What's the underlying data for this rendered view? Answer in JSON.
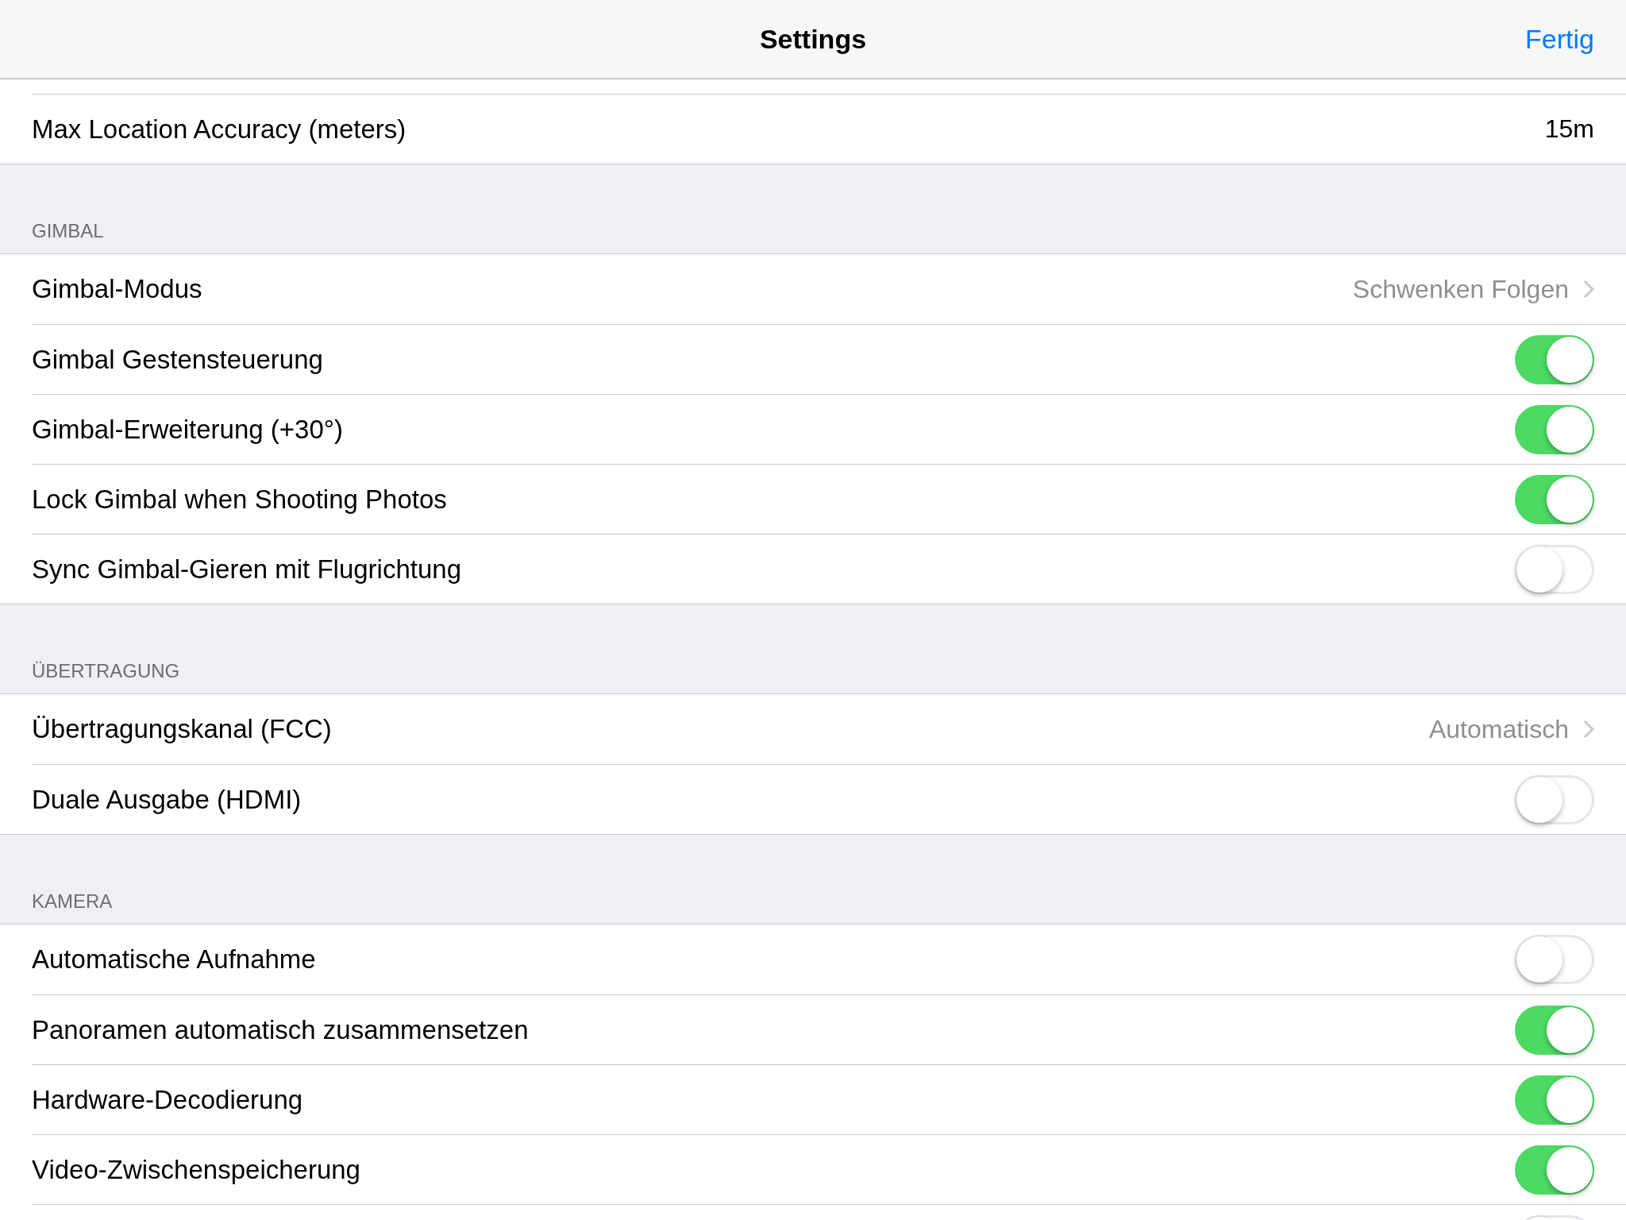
{
  "nav_bar": {
    "title": "Settings",
    "done_button": "Fertig"
  },
  "sections": [
    {
      "rows": [
        {
          "kind": "value",
          "label": "Max Location Accuracy (meters)",
          "value": "15m"
        }
      ]
    },
    {
      "header": "GIMBAL",
      "rows": [
        {
          "kind": "disclosure",
          "label": "Gimbal-Modus",
          "value": "Schwenken Folgen"
        },
        {
          "kind": "toggle",
          "label": "Gimbal Gestensteuerung",
          "on": true
        },
        {
          "kind": "toggle",
          "label": "Gimbal-Erweiterung (+30°)",
          "on": true
        },
        {
          "kind": "toggle",
          "label": "Lock Gimbal when Shooting Photos",
          "on": true
        },
        {
          "kind": "toggle",
          "label": "Sync Gimbal-Gieren mit Flugrichtung",
          "on": false
        }
      ]
    },
    {
      "header": "ÜBERTRAGUNG",
      "rows": [
        {
          "kind": "disclosure",
          "label": "Übertragungskanal (FCC)",
          "value": "Automatisch"
        },
        {
          "kind": "toggle",
          "label": "Duale Ausgabe (HDMI)",
          "on": false
        }
      ]
    },
    {
      "header": "KAMERA",
      "rows": [
        {
          "kind": "toggle",
          "label": "Automatische Aufnahme",
          "on": false
        },
        {
          "kind": "toggle",
          "label": "Panoramen automatisch zusammensetzen",
          "on": true
        },
        {
          "kind": "toggle",
          "label": "Hardware-Decodierung",
          "on": true
        },
        {
          "kind": "toggle",
          "label": "Video-Zwischenspeicherung",
          "on": true
        },
        {
          "kind": "toggle",
          "on": false
        }
      ]
    }
  ]
}
